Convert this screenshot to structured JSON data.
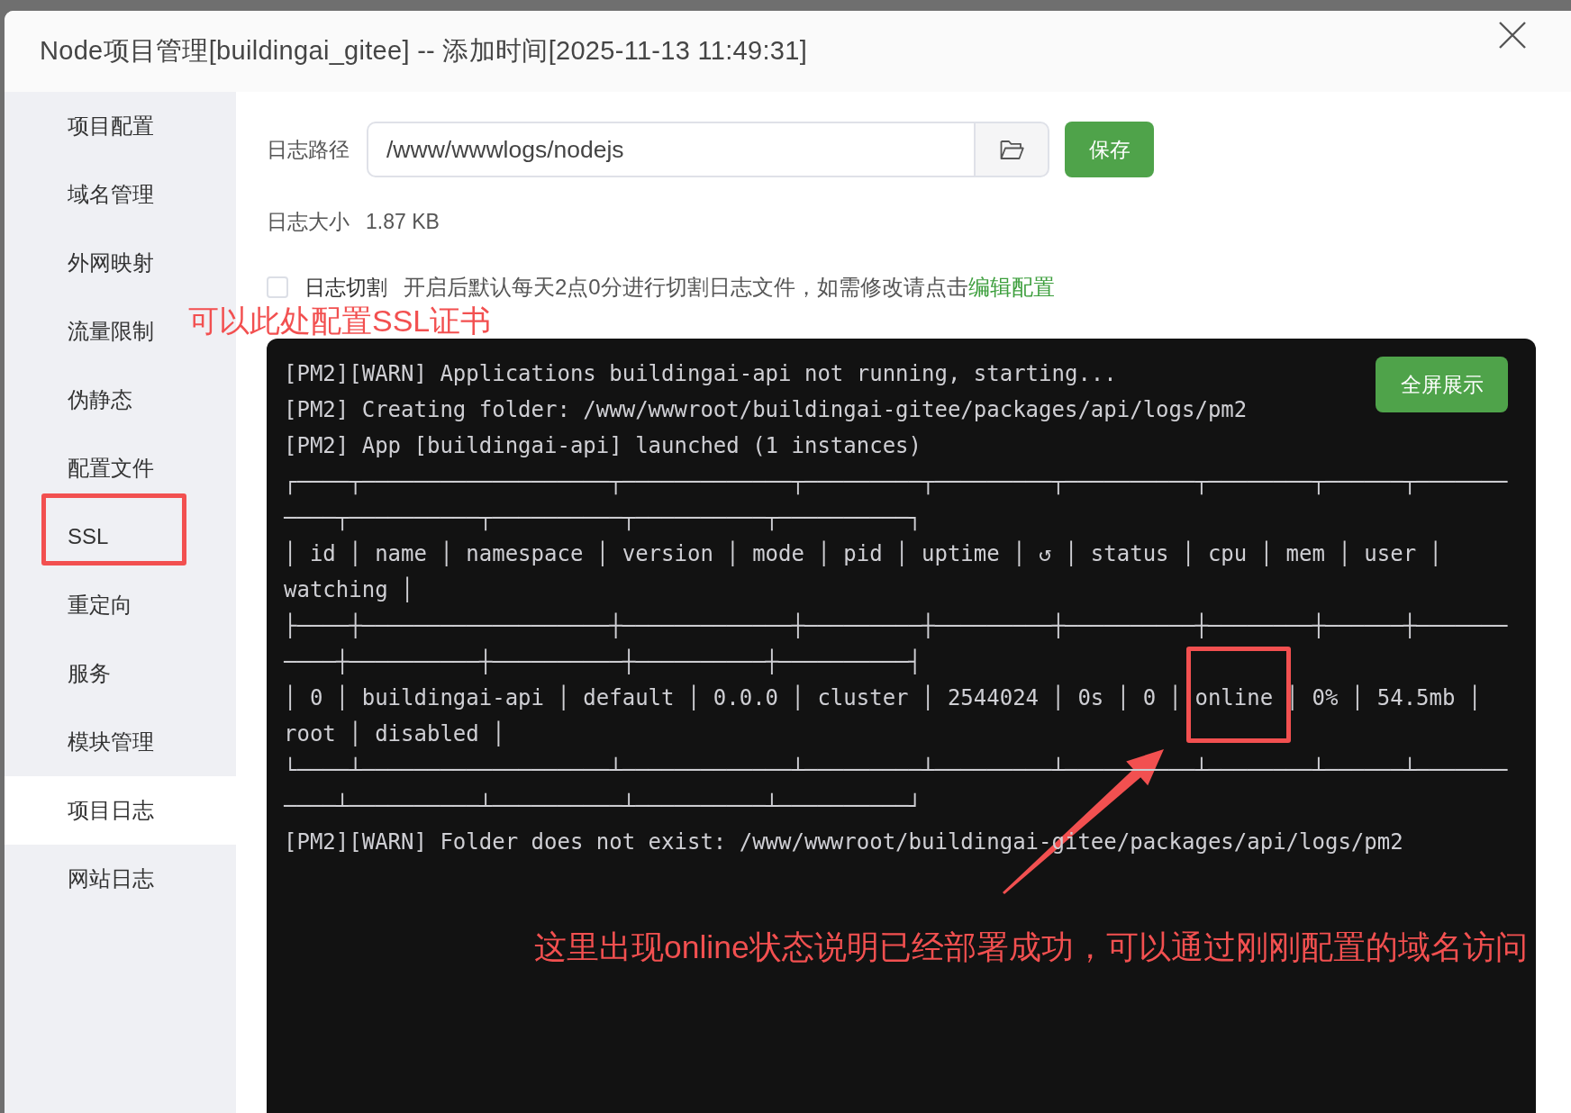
{
  "window": {
    "title": "Node项目管理[buildingai_gitee] -- 添加时间[2025-11-13 11:49:31]"
  },
  "sidebar": {
    "items": [
      {
        "label": "项目配置",
        "selected": false
      },
      {
        "label": "域名管理",
        "selected": false
      },
      {
        "label": "外网映射",
        "selected": false
      },
      {
        "label": "流量限制",
        "selected": false
      },
      {
        "label": "伪静态",
        "selected": false
      },
      {
        "label": "配置文件",
        "selected": false
      },
      {
        "label": "SSL",
        "selected": false
      },
      {
        "label": "重定向",
        "selected": false
      },
      {
        "label": "服务",
        "selected": false
      },
      {
        "label": "模块管理",
        "selected": false
      },
      {
        "label": "项目日志",
        "selected": true
      },
      {
        "label": "网站日志",
        "selected": false
      }
    ]
  },
  "log_path": {
    "label": "日志路径",
    "value": "/www/wwwlogs/nodejs",
    "save_button": "保存"
  },
  "log_size": {
    "label": "日志大小",
    "value": "1.87 KB"
  },
  "log_rotate": {
    "label": "日志切割",
    "checked": false,
    "hint": "开启后默认每天2点0分进行切割日志文件，如需修改请点击",
    "link": "编辑配置"
  },
  "console": {
    "fullscreen_button": "全屏展示",
    "lines": [
      "[PM2][WARN] Applications buildingai-api not running, starting...",
      "[PM2] Creating folder: /www/wwwroot/buildingai-gitee/packages/api/logs/pm2",
      "[PM2] App [buildingai-api] launched (1 instances)",
      "┌────┬───────────────────┬─────────────┬─────────┬─────────┬──────────┬────────┬──────┬───────",
      "────┬──────────┬──────────┬──────────┬──────────┐",
      "│ id │ name │ namespace │ version │ mode │ pid │ uptime │ ↺ │ status │ cpu │ mem │ user │",
      "watching │",
      "├────┼───────────────────┼─────────────┼─────────┼─────────┼──────────┼────────┼──────┼───────",
      "────┼──────────┼──────────┼──────────┼──────────┤",
      "│ 0 │ buildingai-api │ default │ 0.0.0 │ cluster │ 2544024 │ 0s │ 0 │ online │ 0% │ 54.5mb │",
      "root │ disabled │",
      "└────┴───────────────────┴─────────────┴─────────┴─────────┴──────────┴────────┴──────┴───────",
      "────┴──────────┴──────────┴──────────┴──────────┘",
      "[PM2][WARN] Folder does not exist: /www/wwwroot/buildingai-gitee/packages/api/logs/pm2"
    ]
  },
  "annotations": [
    {
      "text": "可以此处配置SSL证书"
    },
    {
      "text": "这里出现online状态说明已经部署成功，可以通过刚刚配置的域名访问"
    }
  ]
}
